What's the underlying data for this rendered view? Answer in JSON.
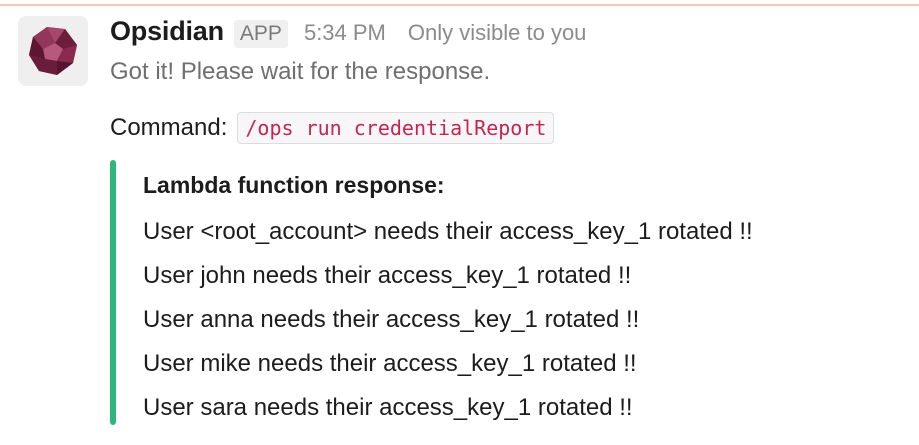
{
  "message": {
    "sender": "Opsidian",
    "badge": "APP",
    "time": "5:34 PM",
    "visibility": "Only visible to you",
    "status": "Got it! Please wait for the response.",
    "command_label": "Command:",
    "command": "/ops run credentialReport",
    "avatar_icon": "gem-icon",
    "colors": {
      "accent_bar": "#2eb67d",
      "code_text": "#c7254e",
      "avatar_gem": "#8a2a4e"
    }
  },
  "attachment": {
    "title": "Lambda function response:",
    "lines": [
      "User <root_account> needs their access_key_1 rotated !!",
      "User john needs their access_key_1 rotated !!",
      "User anna needs their access_key_1 rotated !!",
      "User mike needs their access_key_1 rotated !!",
      "User sara needs their access_key_1 rotated !!"
    ]
  }
}
